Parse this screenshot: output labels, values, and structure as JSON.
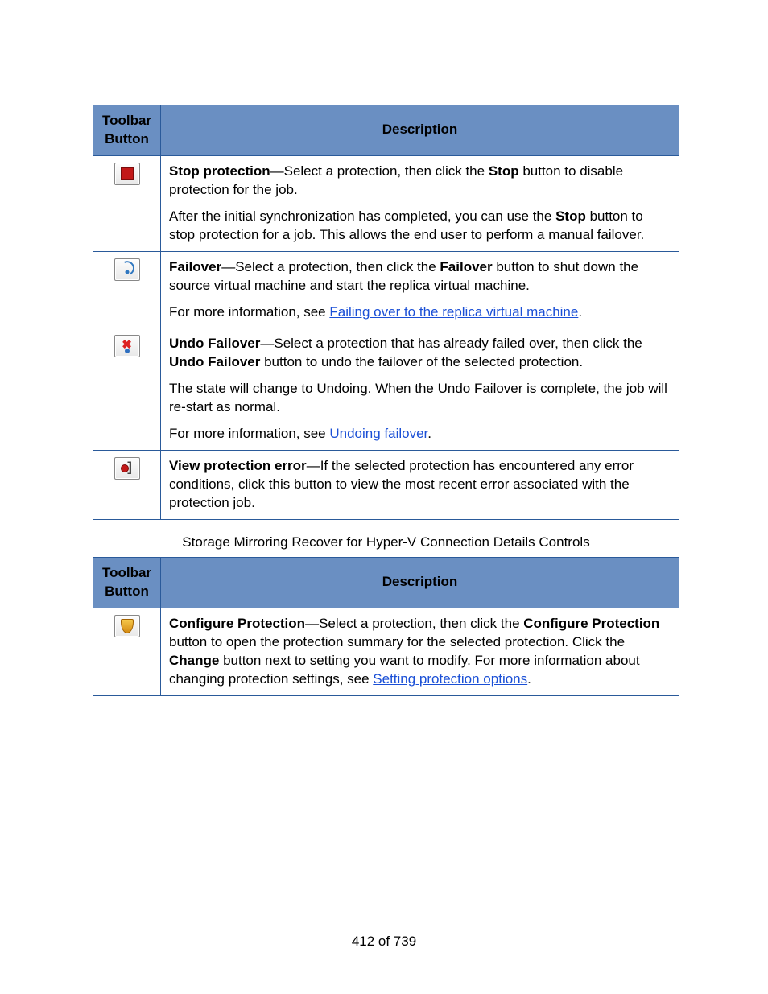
{
  "table1": {
    "headers": {
      "col1": "Toolbar Button",
      "col2": "Description"
    },
    "rows": [
      {
        "icon": "stop",
        "p1_b1": "Stop protection",
        "p1_rest": "—Select a protection, then click the ",
        "p1_b2": "Stop",
        "p1_tail": " button to disable protection for the job.",
        "p2_a": "After the initial synchronization has completed, you can use the ",
        "p2_b": "Stop",
        "p2_c": " button to stop protection for a job. This allows the end user to perform a manual failover."
      },
      {
        "icon": "failover",
        "p1_b1": "Failover",
        "p1_rest": "—Select a protection, then click the ",
        "p1_b2": "Failover",
        "p1_tail": " button to shut down the source virtual machine and start the replica virtual machine.",
        "p2_lead": "For more information, see ",
        "p2_link": "Failing over to the replica virtual machine",
        "p2_end": "."
      },
      {
        "icon": "undo",
        "p1_b1": "Undo Failover",
        "p1_rest": "—Select a protection that has already failed over, then click the ",
        "p1_b2": "Undo Failover",
        "p1_tail": " button to undo the failover of the selected protection.",
        "p2": "The state will change to Undoing. When the Undo Failover is complete, the job will re-start as normal.",
        "p3_lead": "For more information, see ",
        "p3_link": "Undoing failover",
        "p3_end": "."
      },
      {
        "icon": "err",
        "p1_b1": "View protection error",
        "p1_rest": "—If the selected protection has encountered any error conditions, click this button to view the most recent error associated with the protection job."
      }
    ]
  },
  "caption": "Storage Mirroring Recover for Hyper-V Connection Details Controls",
  "table2": {
    "headers": {
      "col1": "Toolbar Button",
      "col2": "Description"
    },
    "rows": [
      {
        "icon": "cfg",
        "p1_b1": "Configure Protection",
        "p1_a": "—Select a protection, then click the ",
        "p1_b2": "Configure Protection",
        "p1_b": " button to open the protection summary for the selected protection. Click the ",
        "p1_b3": "Change",
        "p1_c": " button next to setting you want to modify. For more information about changing protection settings, see ",
        "p1_link": "Setting protection options",
        "p1_end": "."
      }
    ]
  },
  "footer": "412 of 739"
}
